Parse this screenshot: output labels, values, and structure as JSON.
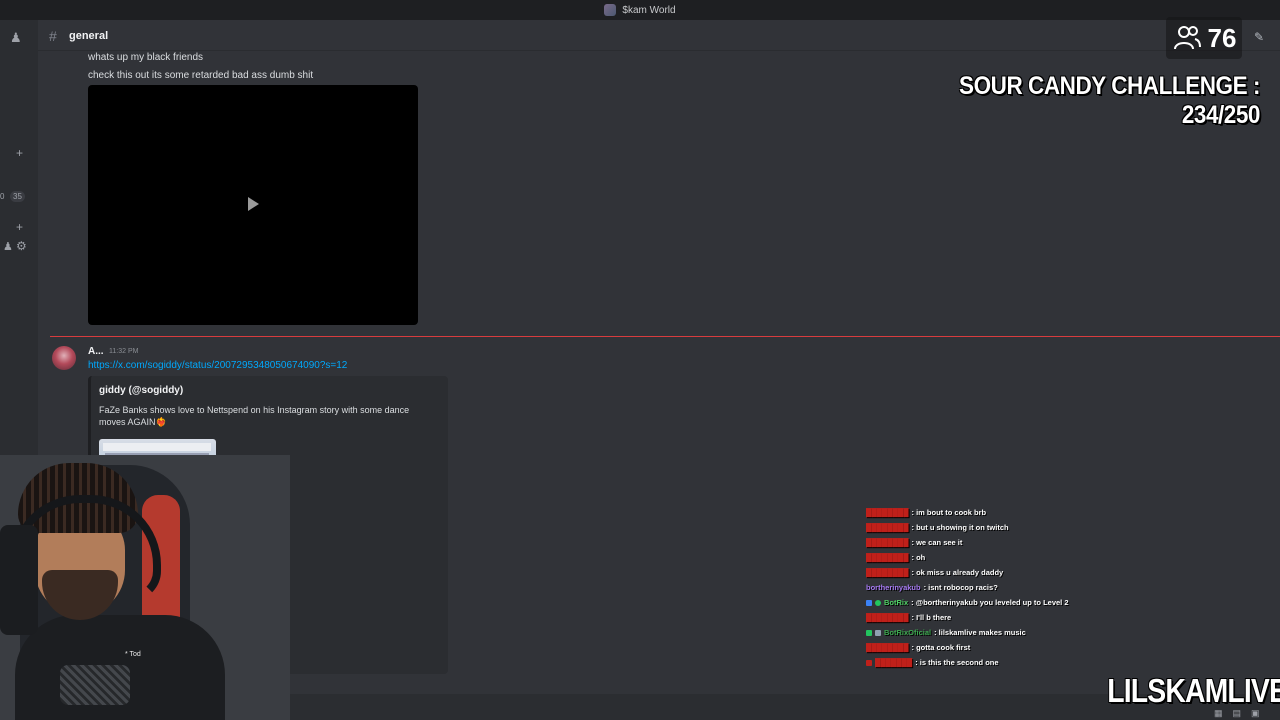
{
  "window": {
    "title": "$kam World"
  },
  "channel": {
    "name": "general"
  },
  "sidebar": {
    "plus_1": "+",
    "counts": [
      "0",
      "35"
    ],
    "plus_2": "+"
  },
  "messages": {
    "line1": "whats up my black friends",
    "line2": "check this out its some retarded bad ass dumb shit",
    "second": {
      "author": "A...",
      "time": "11:32 PM",
      "link": "https://x.com/sogiddy/status/2007295348050674090?s=12",
      "embed_title": "giddy (@sogiddy)",
      "embed_desc": "FaZe Banks shows love to Nettspend on his Instagram story with some dance moves AGAIN❤️‍🔥"
    }
  },
  "overlay": {
    "viewers": "76",
    "challenge": "SOUR CANDY CHALLENGE : 234/250",
    "brand": "LILSKAMLIVE"
  },
  "webcam": {
    "tag": "* Tod"
  },
  "chat": [
    {
      "user": "",
      "user_color": "#c0201a",
      "text": ": im bout to cook brb"
    },
    {
      "user": "",
      "user_color": "#c0201a",
      "text": ": but u showing it on twitch"
    },
    {
      "user": "",
      "user_color": "#c0201a",
      "text": ": we can see it"
    },
    {
      "user": "",
      "user_color": "#c0201a",
      "text": ": oh"
    },
    {
      "user": "",
      "user_color": "#c0201a",
      "text": ": ok miss u already daddy"
    },
    {
      "user": "bortherinyakub",
      "user_color": "#a77bf3",
      "text": ": isnt robocop racis?"
    },
    {
      "user": "BotRix",
      "user_color": "#4fd065",
      "text": ": @bortherinyakub you leveled up to Level 2"
    },
    {
      "user": "",
      "user_color": "#c0201a",
      "text": ": I'll b there"
    },
    {
      "user": "BotRixOficial",
      "user_color": "#3da84f",
      "text": ": lilskamlive makes music"
    },
    {
      "user": "",
      "user_color": "#c0201a",
      "text": ": gotta cook first"
    },
    {
      "user": "",
      "user_color": "#c0201a",
      "text": ": is this the second one"
    }
  ],
  "colors": {
    "background": "#313338",
    "link": "#00a8fc",
    "new_divider": "#d83c3e"
  }
}
